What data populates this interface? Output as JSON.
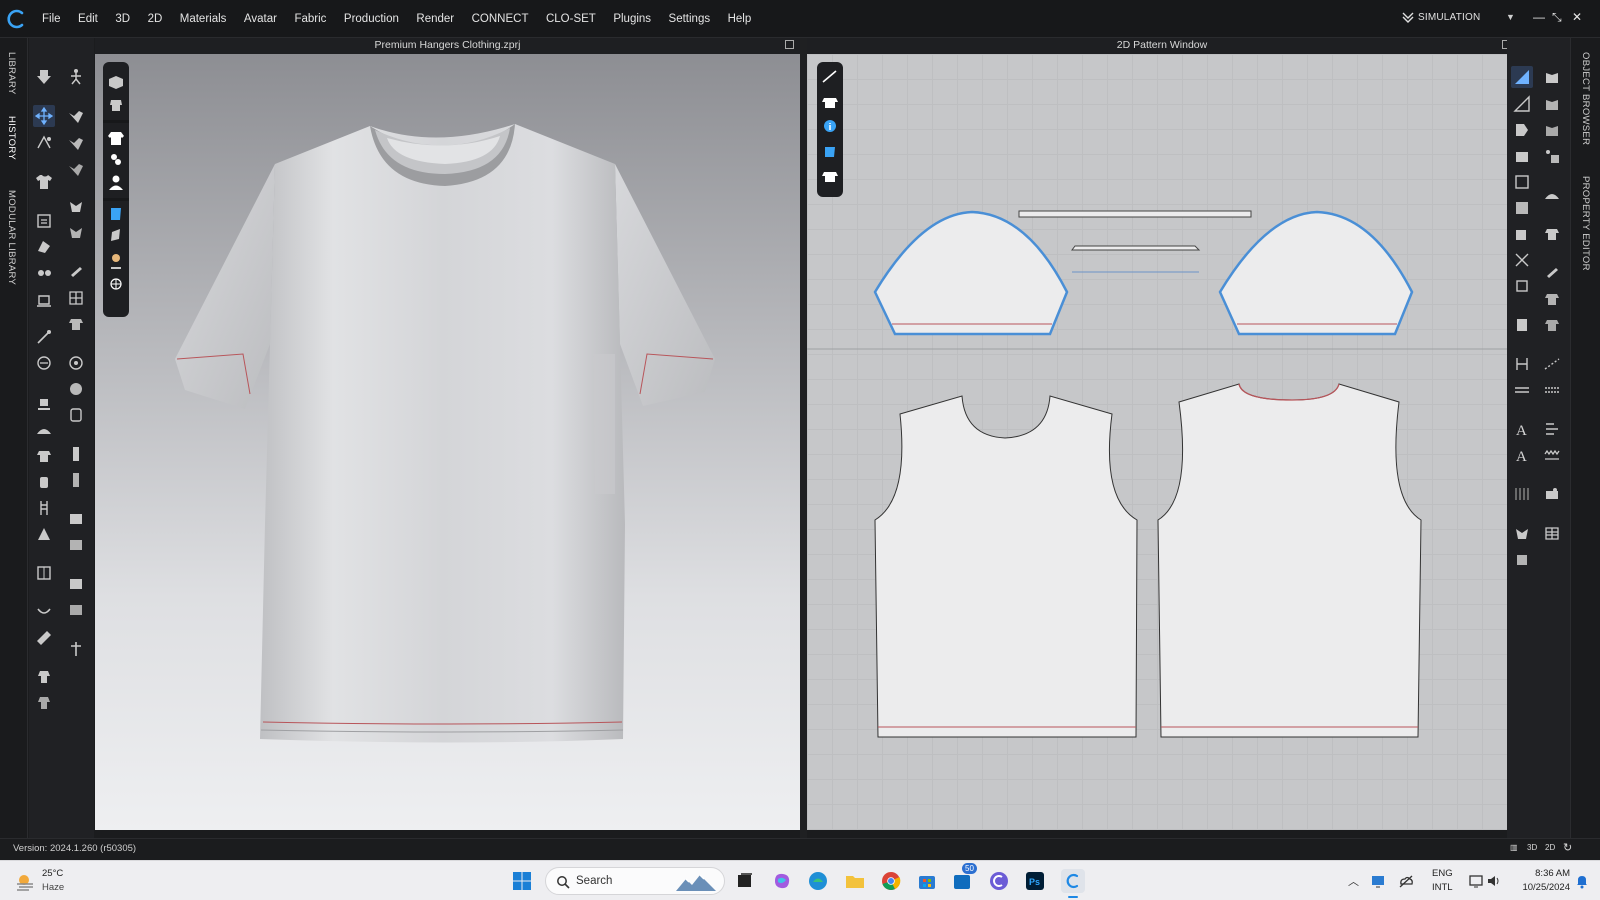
{
  "app": {
    "menu": [
      "File",
      "Edit",
      "3D",
      "2D",
      "Materials",
      "Avatar",
      "Fabric",
      "Production",
      "Render",
      "CONNECT",
      "CLO-SET",
      "Plugins",
      "Settings",
      "Help"
    ],
    "mode_label": "SIMULATION"
  },
  "left_tabs": [
    "LIBRARY",
    "HISTORY",
    "MODULAR LIBRARY"
  ],
  "right_tabs": [
    "OBJECT BROWSER",
    "PROPERTY EDITOR"
  ],
  "window3d": {
    "title": "Premium Hangers Clothing.zprj"
  },
  "window2d": {
    "title": "2D Pattern Window"
  },
  "status": {
    "version": "Version: 2024.1.260 (r50305)",
    "view_buttons": [
      "3D",
      "2D"
    ]
  },
  "taskbar": {
    "weather_temp": "25°C",
    "weather_desc": "Haze",
    "search_label": "Search",
    "badge_count": "50",
    "lang_line1": "ENG",
    "lang_line2": "INTL",
    "time": "8:36 AM",
    "date": "10/25/2024"
  },
  "colors": {
    "accent_blue": "#4a8fd6",
    "seam_red": "#b8555a",
    "chrome_dark": "#17181a"
  }
}
